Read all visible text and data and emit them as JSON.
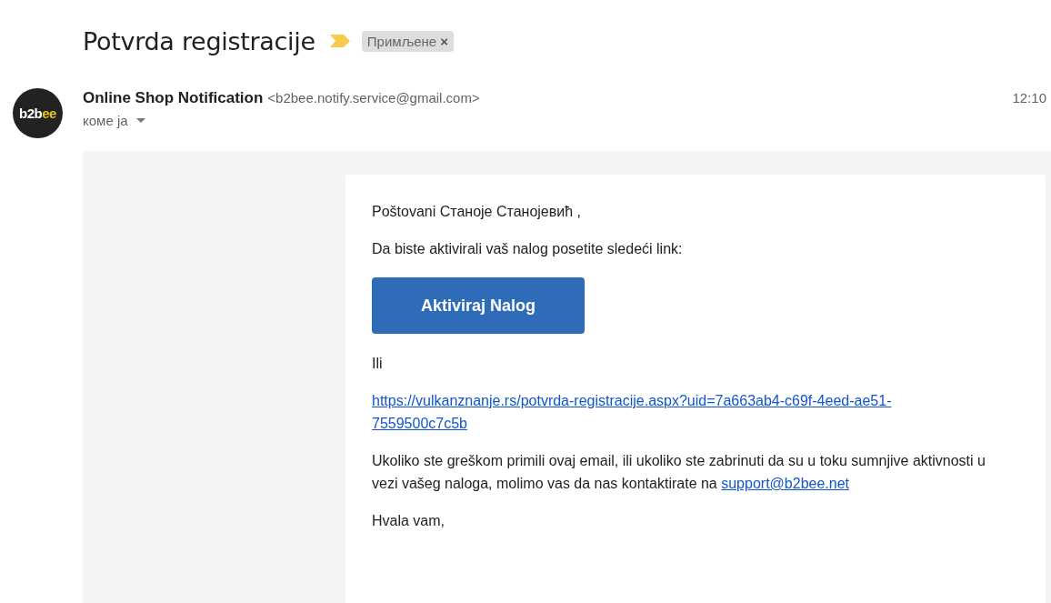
{
  "subject": "Potvrda registracije",
  "label": {
    "text": "Примљене",
    "close": "×"
  },
  "sender": {
    "logo": [
      {
        "text": "b2b",
        "color": "#ffffff"
      },
      {
        "text": "ee",
        "color": "#e3c616"
      }
    ],
    "name": "Online Shop Notification",
    "email": "<b2bee.notify.service@gmail.com>",
    "to": "коме ја",
    "time": "12:10"
  },
  "body": [
    {
      "kind": "text",
      "text": "Poštovani Станоје Станојевић ,"
    },
    {
      "kind": "text",
      "text": "Da biste aktivirali vaš nalog posetite sledeći link:"
    },
    {
      "kind": "button",
      "text": "Aktiviraj Nalog"
    },
    {
      "kind": "text",
      "text": "Ili"
    },
    {
      "kind": "link",
      "text": "https://vulkanznanje.rs/potvrda-registracije.aspx?uid=7a663ab4-c69f-4eed-ae51-7559500c7c5b"
    },
    {
      "kind": "text_link",
      "text": "Ukoliko ste greškom primili ovaj email, ili ukoliko ste zabrinuti da su u toku sumnjive aktivnosti u vezi vašeg naloga, molimo vas da nas kontaktirate na",
      "link": "support@b2bee.net"
    },
    {
      "kind": "text",
      "text": "Hvala vam,"
    }
  ]
}
